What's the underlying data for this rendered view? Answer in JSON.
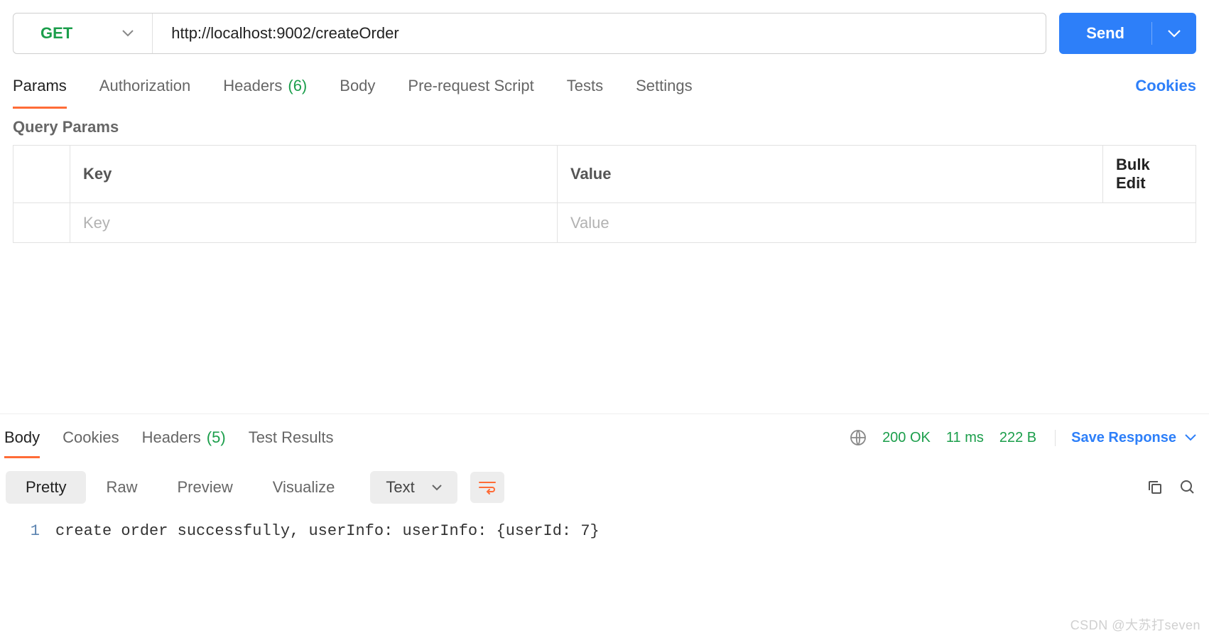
{
  "request": {
    "method": "GET",
    "url": "http://localhost:9002/createOrder",
    "send_label": "Send"
  },
  "tabs": {
    "params": "Params",
    "authorization": "Authorization",
    "headers_label": "Headers",
    "headers_count": "(6)",
    "body": "Body",
    "prerequest": "Pre-request Script",
    "tests": "Tests",
    "settings": "Settings",
    "cookies": "Cookies"
  },
  "query_params": {
    "section_label": "Query Params",
    "header_key": "Key",
    "header_value": "Value",
    "bulk_edit": "Bulk Edit",
    "placeholder_key": "Key",
    "placeholder_value": "Value"
  },
  "response": {
    "tabs": {
      "body": "Body",
      "cookies": "Cookies",
      "headers_label": "Headers",
      "headers_count": "(5)",
      "test_results": "Test Results"
    },
    "status": "200 OK",
    "time": "11 ms",
    "size": "222 B",
    "save_label": "Save Response",
    "views": {
      "pretty": "Pretty",
      "raw": "Raw",
      "preview": "Preview",
      "visualize": "Visualize"
    },
    "format": "Text",
    "line_number": "1",
    "body_text": "create order successfully, userInfo: userInfo: {userId: 7}"
  },
  "watermark": "CSDN @大苏打seven",
  "colors": {
    "accent_orange": "#ff6c37",
    "accent_blue": "#2d7ff9",
    "success_green": "#1b9e4b"
  }
}
